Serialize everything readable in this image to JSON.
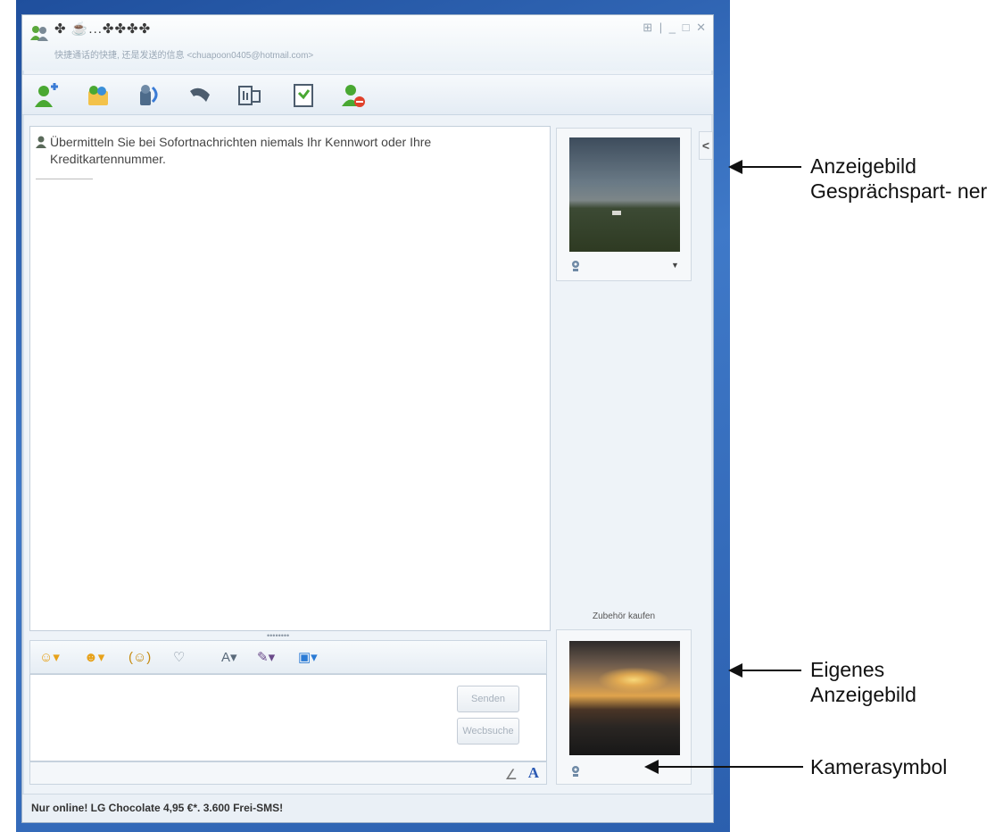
{
  "window": {
    "contact_name": "✤ ☕...✤✤✤✤",
    "contact_status": "快捷通话的快捷, 还是发送的信息 <chuapoon0405@hotmail.com>",
    "window_controls": "⊞ | _ □ ✕"
  },
  "toolbar": {
    "items": [
      "invite-contact",
      "share-folders",
      "video-call",
      "phone-call",
      "games",
      "activities",
      "block-contact"
    ]
  },
  "conversation": {
    "warning_text": "Übermitteln Sie bei Sofortnachrichten niemals Ihr Kennwort oder Ihre Kreditkartennummer."
  },
  "input": {
    "send_label": "Senden",
    "nudge_label": "Wecbsuche",
    "emote_items": [
      "☺▾",
      "☻▾",
      "(☺)",
      "♡",
      "A▾",
      "✎▾",
      "▣▾"
    ]
  },
  "sidebar": {
    "shop_link": "Zubehör kaufen",
    "collapse_label": "<"
  },
  "footer": {
    "ad_text": "Nur online! LG Chocolate 4,95 €*. 3.600 Frei-SMS!"
  },
  "annotations": {
    "partner_picture": "Anzeigebild Gesprächspart- ner",
    "own_picture": "Eigenes Anzeigebild",
    "camera_symbol": "Kamerasymbol"
  },
  "colors": {
    "accent": "#2b59b3",
    "window_bg": "#eef3f8",
    "backdrop": "#3f79c8"
  }
}
